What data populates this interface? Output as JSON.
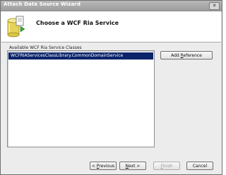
{
  "window": {
    "title": "Attach Data Source Wizard",
    "close_glyph": "✕"
  },
  "header": {
    "title": "Choose a WCF Ria Service",
    "icon": "database-wizard-icon"
  },
  "list": {
    "label": "Available WCF Ria Service Classes",
    "items": [
      "WCFRIAServicesClassLibrary.CommonDomainService"
    ],
    "selected_index": 0
  },
  "buttons": {
    "add_reference": {
      "pre": "Add ",
      "accel": "R",
      "post": "eference"
    },
    "previous": {
      "pre": "< ",
      "accel": "P",
      "post": "revious"
    },
    "next": {
      "pre": "",
      "accel": "N",
      "post": "ext >"
    },
    "finish": {
      "pre": "",
      "accel": "F",
      "post": "inish"
    },
    "cancel": {
      "pre": "",
      "accel": "",
      "post": "Cancel"
    }
  },
  "colors": {
    "selection": "#0a246a",
    "titlebar": "#a9a9a9",
    "header_bg": "#ffffff"
  }
}
